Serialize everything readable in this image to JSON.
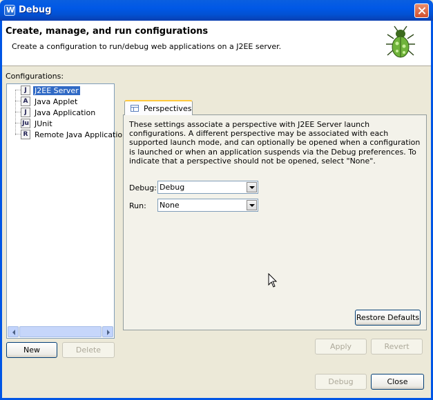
{
  "window": {
    "title": "Debug"
  },
  "banner": {
    "title": "Create, manage, and run configurations",
    "message": "Create a configuration to run/debug web applications on a J2EE server."
  },
  "configurations_label": "Configurations:",
  "tree": {
    "items": [
      {
        "label": "J2EE Server",
        "icon": "j2ee-server-icon",
        "glyph": "J",
        "selected": true
      },
      {
        "label": "Java Applet",
        "icon": "java-applet-icon",
        "glyph": "A",
        "selected": false
      },
      {
        "label": "Java Application",
        "icon": "java-application-icon",
        "glyph": "J",
        "selected": false
      },
      {
        "label": "JUnit",
        "icon": "junit-icon",
        "glyph": "Ju",
        "selected": false
      },
      {
        "label": "Remote Java Application",
        "icon": "remote-java-application-icon",
        "glyph": "R",
        "selected": false
      }
    ]
  },
  "tree_buttons": {
    "new": "New",
    "delete": "Delete"
  },
  "tab": {
    "label": "Perspectives"
  },
  "perspectives": {
    "description": "These settings associate a perspective with J2EE Server launch configurations. A different perspective may be associated with each supported launch mode, and can optionally be opened when a configuration is launched or when an application suspends via the Debug preferences. To indicate that a perspective should not be opened, select \"None\".",
    "debug_label": "Debug:",
    "debug_value": "Debug",
    "run_label": "Run:",
    "run_value": "None",
    "restore_defaults": "Restore Defaults"
  },
  "actions": {
    "apply": "Apply",
    "revert": "Revert",
    "debug": "Debug",
    "close": "Close"
  }
}
